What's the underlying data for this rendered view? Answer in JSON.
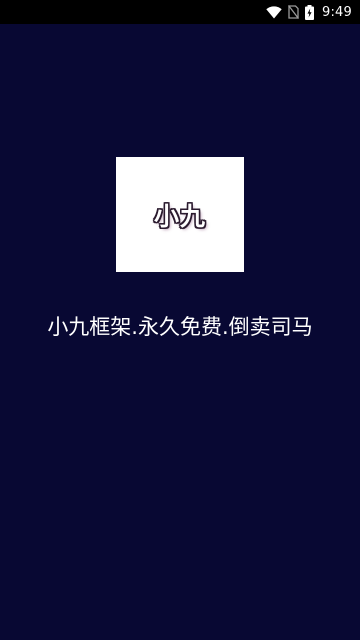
{
  "status_bar": {
    "time": "9:49",
    "icons": [
      "wifi-icon",
      "no-sim-icon",
      "battery-charging-icon"
    ]
  },
  "splash": {
    "logo_text": "小九",
    "slogan": "小九框架.永久免费.倒卖司马"
  },
  "colors": {
    "background": "#080833",
    "status_bar": "#000000",
    "logo_box": "#ffffff",
    "text": "#ffffff"
  }
}
